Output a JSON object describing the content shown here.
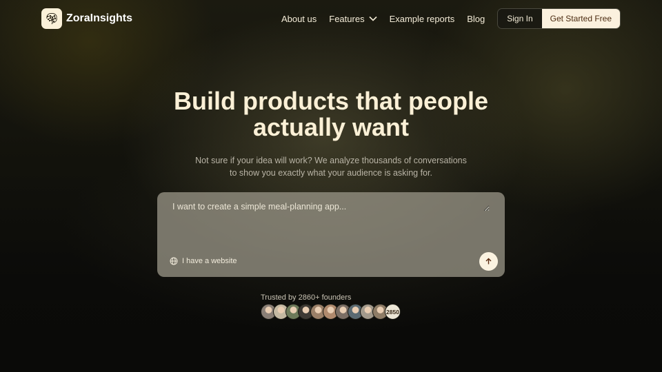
{
  "brand": {
    "name": "ZoraInsights",
    "logo_icon": "brain-network-icon"
  },
  "nav": {
    "links": [
      {
        "label": "About us"
      },
      {
        "label": "Features",
        "icon": "chevron-down-icon"
      },
      {
        "label": "Example reports"
      },
      {
        "label": "Blog"
      }
    ],
    "sign_in": "Sign In",
    "get_started": "Get Started Free"
  },
  "hero": {
    "title_line1": "Build products that people",
    "title_line2": "actually want",
    "subtitle_line1": "Not sure if your idea will work? We analyze thousands of conversations",
    "subtitle_line2": "to show you exactly what your audience is asking for."
  },
  "prompt": {
    "placeholder": "I want to create a simple meal-planning app...",
    "website_toggle": "I have a website",
    "website_icon": "globe-icon",
    "send_icon": "arrow-up-icon"
  },
  "social_proof": {
    "trusted_text": "Trusted by 2860+ founders",
    "avatar_count_label": "2850",
    "avatar_colors": [
      "#8a7f76",
      "#c4b9a2",
      "#6d7a5a",
      "#3e3a34",
      "#9b8068",
      "#b08a6d",
      "#7b6e64",
      "#5a6a72",
      "#a39a8c",
      "#8e7c66"
    ]
  },
  "colors": {
    "accent_cream": "#fbf1de",
    "button_text": "#4a2a0f",
    "title_color": "#fbf0d6"
  }
}
